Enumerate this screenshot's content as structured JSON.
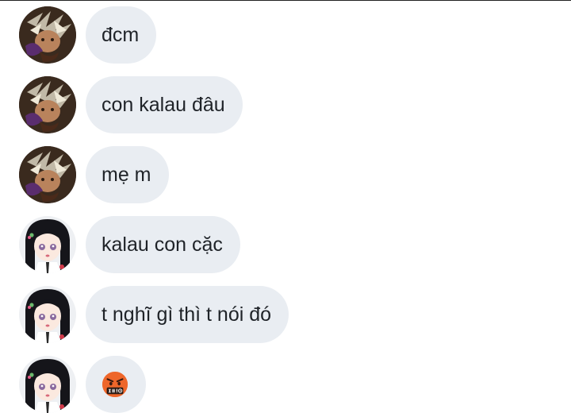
{
  "messages": [
    {
      "avatar": "dark-haired-character-avatar",
      "text": "đcm"
    },
    {
      "avatar": "dark-haired-character-avatar",
      "text": "con kalau đâu"
    },
    {
      "avatar": "dark-haired-character-avatar",
      "text": "mẹ m"
    },
    {
      "avatar": "kanao-character-avatar",
      "text": "kalau con cặc"
    },
    {
      "avatar": "kanao-character-avatar",
      "text": "t nghĩ gì thì t nói đó"
    },
    {
      "avatar": "kanao-character-avatar",
      "emoji": "face-with-symbols-on-mouth-icon"
    }
  ],
  "colors": {
    "bubble": "#e9edf2",
    "text": "#1f2328",
    "background": "#ffffff"
  }
}
